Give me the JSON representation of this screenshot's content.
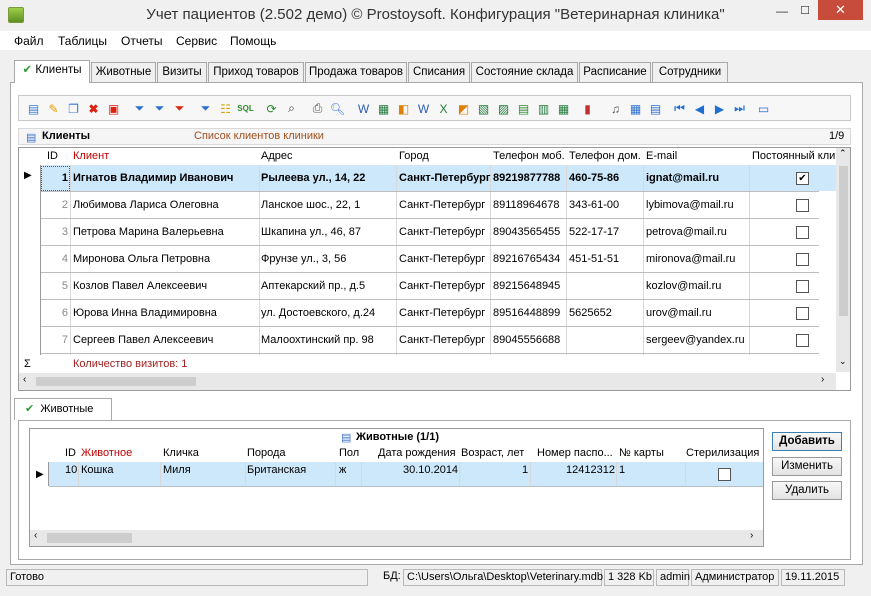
{
  "window": {
    "title": "Учет пациентов (2.502 демо) © Prostoysoft. Конфигурация \"Ветеринарная клиника\"",
    "close": "✕",
    "min": "—",
    "max": "☐"
  },
  "menu": [
    "Файл",
    "Таблицы",
    "Отчеты",
    "Сервис",
    "Помощь"
  ],
  "tabs": [
    "Клиенты",
    "Животные",
    "Визиты",
    "Приход товаров",
    "Продажа товаров",
    "Списания",
    "Состояние склада",
    "Расписание",
    "Сотрудники"
  ],
  "panel": {
    "title": "Клиенты",
    "subtitle": "Список клиентов клиники",
    "counter": "1/9"
  },
  "clients": {
    "columns": [
      "ID",
      "Клиент",
      "Адрес",
      "Город",
      "Телефон моб.",
      "Телефон дом.",
      "E-mail",
      "Постоянный кли"
    ],
    "rows": [
      {
        "id": "1",
        "name": "Игнатов Владимир Иванович",
        "address": "Рылеева ул., 14, 22",
        "city": "Санкт-Петербург",
        "mob": "89219877788",
        "home": "460-75-86",
        "email": "ignat@mail.ru",
        "regular": true
      },
      {
        "id": "2",
        "name": "Любимова Лариса Олеговна",
        "address": "Ланское шос., 22, 1",
        "city": "Санкт-Петербург",
        "mob": "89118964678",
        "home": "343-61-00",
        "email": "lybimova@mail.ru",
        "regular": false
      },
      {
        "id": "3",
        "name": "Петрова Марина Валерьевна",
        "address": "Шкапина ул., 46, 87",
        "city": "Санкт-Петербург",
        "mob": "89043565455",
        "home": "522-17-17",
        "email": "petrova@mail.ru",
        "regular": false
      },
      {
        "id": "4",
        "name": "Миронова Ольга Петровна",
        "address": "Фрунзе ул., 3, 56",
        "city": "Санкт-Петербург",
        "mob": "89216765434",
        "home": "451-51-51",
        "email": "mironova@mail.ru",
        "regular": false
      },
      {
        "id": "5",
        "name": "Козлов Павел Алексеевич",
        "address": "Аптекарский пр., д.5",
        "city": "Санкт-Петербург",
        "mob": "89215648945",
        "home": "",
        "email": "kozlov@mail.ru",
        "regular": false
      },
      {
        "id": "6",
        "name": "Юрова Инна Владимировна",
        "address": "ул. Достоевского, д.24",
        "city": "Санкт-Петербург",
        "mob": "89516448899",
        "home": "5625652",
        "email": "urov@mail.ru",
        "regular": false
      },
      {
        "id": "7",
        "name": "Сергеев Павел Алексеевич",
        "address": "Малоохтинский пр. 98",
        "city": "Санкт-Петербург",
        "mob": "89045556688",
        "home": "",
        "email": "sergeev@yandex.ru",
        "regular": false
      }
    ],
    "sigma": "Σ",
    "footer": "Количество визитов: 1"
  },
  "subtab": "Животные",
  "animals": {
    "title": "Животные (1/1)",
    "columns": [
      "ID",
      "Животное",
      "Кличка",
      "Порода",
      "Пол",
      "Дата рождения",
      "Возраст, лет",
      "Номер паспо...",
      "№ карты",
      "Стерилизация"
    ],
    "rows": [
      {
        "id": "10",
        "animal": "Кошка",
        "nick": "Миля",
        "breed": "Британская",
        "sex": "ж",
        "birth": "30.10.2014",
        "age": "1",
        "passport": "12412312",
        "card": "1",
        "sterile": false
      }
    ]
  },
  "buttons": {
    "add": "Добавить",
    "edit": "Изменить",
    "delete": "Удалить"
  },
  "status": {
    "ready": "Готово",
    "db_label": "БД:",
    "db_path": "C:\\Users\\Ольга\\Desktop\\Veterinary.mdb",
    "size": "1 328 Kb",
    "user": "admin",
    "role": "Администратор",
    "date": "19.11.2015"
  },
  "colors": {
    "selected_row": "#cde8fb",
    "accent_red": "#a02020",
    "header_link": "#c00000"
  },
  "toolbar_icons": [
    "add-record-icon",
    "edit-icon",
    "copy-icon",
    "delete-icon",
    "delete-all-icon",
    "filter-icon",
    "filter-add-icon",
    "filter-remove-icon",
    "filter-quick-icon",
    "group-icon",
    "sql-icon",
    "refresh-icon",
    "find-icon",
    "print-icon",
    "preview-icon",
    "export-word-icon",
    "export-excel-icon",
    "export-html-icon",
    "export-word2-icon",
    "export-excel2-icon",
    "export-csv-icon",
    "export-xml-icon",
    "chart-icon",
    "settings-icon",
    "columns-icon",
    "layout-icon",
    "first-icon",
    "prev-icon",
    "next-icon",
    "last-icon",
    "view-icon"
  ]
}
